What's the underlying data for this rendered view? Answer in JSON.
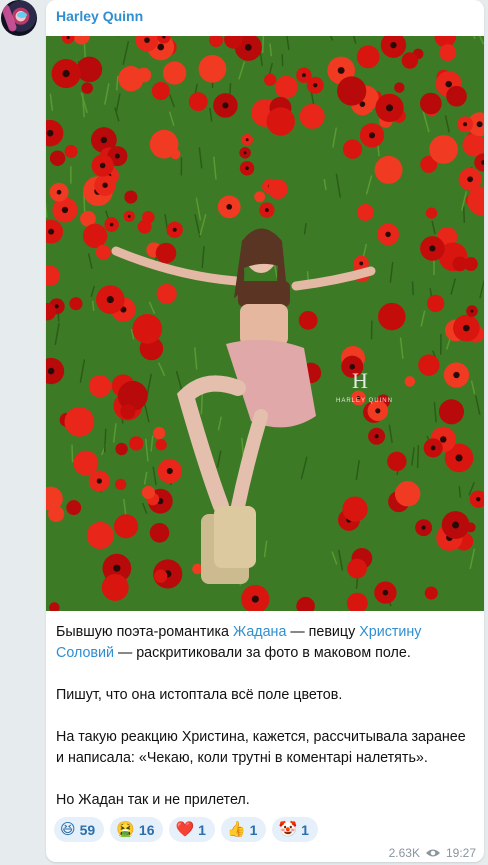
{
  "channel": {
    "name": "Harley Quinn",
    "avatar_icon": "avatar-image"
  },
  "photo": {
    "watermark_initial": "H",
    "watermark_text": "HARLEY QUINN"
  },
  "post": {
    "p1_a": "Бывшую поэта-романтика ",
    "p1_link1": "Жадана",
    "p1_b": " — певицу ",
    "p1_link2": "Христину Соловий",
    "p1_c": " — раскритиковали за фото в маковом поле.",
    "p2": "Пишут, что она истоптала всё поле цветов.",
    "p3": "На такую реакцию Христина, кажется, рассчитывала заранее и написала: «Чекаю, коли трутні в коментарі налетять».",
    "p4": "Но Жадан так и не прилетел."
  },
  "reactions": [
    {
      "emoji": "😆",
      "icon": "laughing-emoji-icon",
      "count": "59"
    },
    {
      "emoji": "🤮",
      "icon": "vomiting-emoji-icon",
      "count": "16"
    },
    {
      "emoji": "❤️",
      "icon": "heart-emoji-icon",
      "count": "1"
    },
    {
      "emoji": "👍",
      "icon": "thumbs-up-emoji-icon",
      "count": "1"
    },
    {
      "emoji": "🤡",
      "icon": "clown-emoji-icon",
      "count": "1"
    }
  ],
  "meta": {
    "views": "2.63K",
    "time": "19:27"
  },
  "colors": {
    "link": "#2f8fd1",
    "reaction_bg": "#e6f0fa",
    "reaction_text": "#2b6fab",
    "chat_bg": "#e6ebee"
  }
}
